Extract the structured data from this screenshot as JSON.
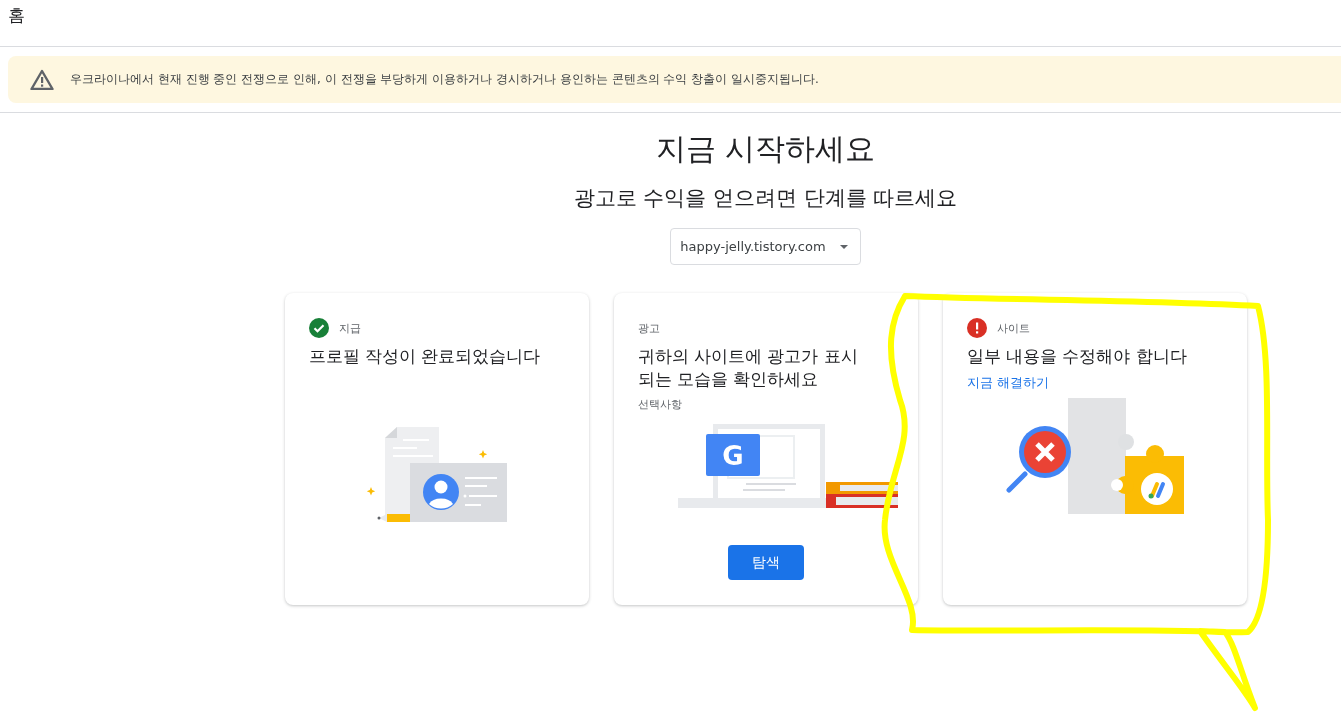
{
  "page_title": "홈",
  "notice": {
    "text": "우크라이나에서 현재 진행 중인 전쟁으로 인해, 이 전쟁을 부당하게 이용하거나 경시하거나 용인하는 콘텐츠의 수익 창출이 일시중지됩니다."
  },
  "heading": "지금 시작하세요",
  "subheading": "광고로 수익을 얻으려면 단계를 따르세요",
  "site_select": {
    "value": "happy-jelly.tistory.com"
  },
  "cards": [
    {
      "kind": "complete",
      "category": "지급",
      "title": "프로필 작성이 완료되었습니다",
      "illustration": {
        "kind": "profile"
      }
    },
    {
      "kind": "plain",
      "category": "광고",
      "title": "귀하의 사이트에 광고가 표시되는 모습을 확인하세요",
      "note": "선택사항",
      "illustration": {
        "kind": "laptop",
        "letter": "G"
      },
      "button": "탐색"
    },
    {
      "kind": "error",
      "category": "사이트",
      "title": "일부 내용을 수정해야 합니다",
      "link": "지금 해결하기",
      "illustration": {
        "kind": "puzzle"
      }
    }
  ]
}
